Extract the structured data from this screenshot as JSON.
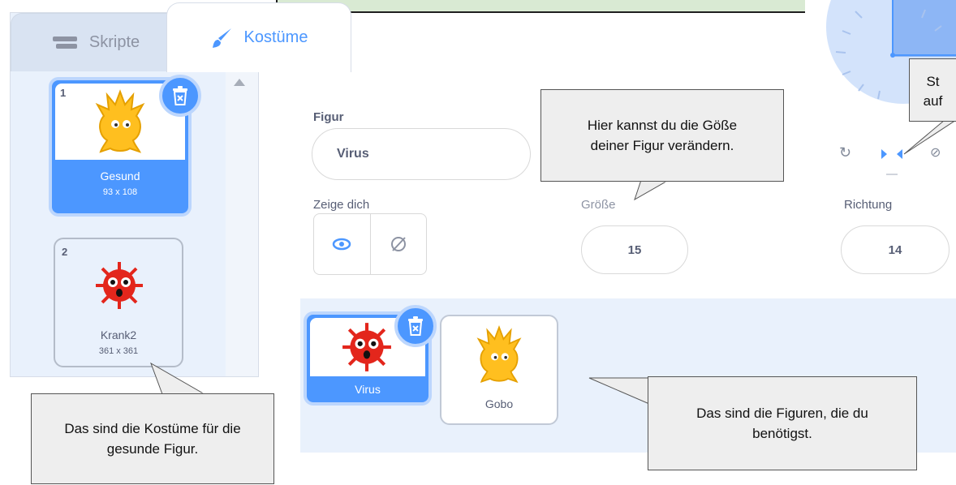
{
  "tabs": {
    "skripte": "Skripte",
    "kostume": "Kostüme"
  },
  "costumes": [
    {
      "number": "1",
      "name": "Gesund",
      "size": "93 x 108",
      "selected": true
    },
    {
      "number": "2",
      "name": "Krank2",
      "size": "361 x 361",
      "selected": false
    }
  ],
  "sprite_info": {
    "figur_label": "Figur",
    "figur_value": "Virus",
    "show_label": "Zeige dich",
    "size_label": "Größe",
    "size_value": "15",
    "direction_label": "Richtung",
    "direction_value": "14"
  },
  "sprites": [
    {
      "name": "Virus",
      "selected": true
    },
    {
      "name": "Gobo",
      "selected": false
    }
  ],
  "callouts": {
    "size": "Hier kannst du die Göße deiner Figur verändern.",
    "costumes": "Das sind die Kostüme für die gesunde Figur.",
    "sprites": "Das sind die Figuren, die du benötigst.",
    "direction_line1": "St",
    "direction_line2": "auf"
  },
  "colors": {
    "accent": "#4c97ff",
    "accent_light": "#bcd6fd",
    "panel": "#e9f1fc",
    "callout_bg": "#eeeeee",
    "green_box": "#d9ead3"
  },
  "icons": [
    "code-blocks-icon",
    "paint-brush-icon",
    "trash-icon",
    "eye-icon",
    "eye-hidden-icon",
    "rotate-icon",
    "left-right-icon",
    "dont-rotate-icon",
    "gobo-sprite",
    "virus-sprite"
  ]
}
